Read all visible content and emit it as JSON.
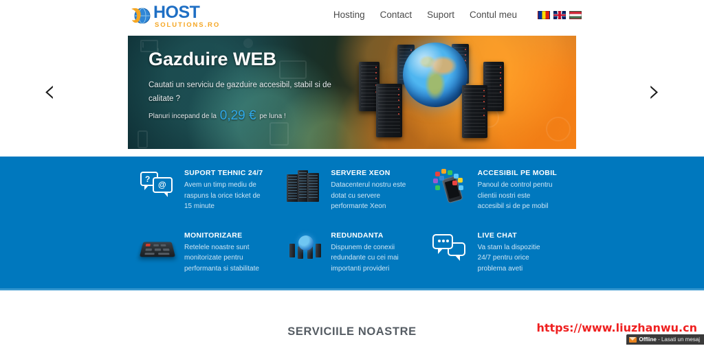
{
  "header": {
    "logo": {
      "name": "HOST",
      "sub": "SOLUTIONS.RO",
      "icon": "globe-swoosh-icon"
    },
    "nav": [
      {
        "label": "Hosting",
        "name": "nav-hosting"
      },
      {
        "label": "Contact",
        "name": "nav-contact"
      },
      {
        "label": "Suport",
        "name": "nav-suport"
      },
      {
        "label": "Contul meu",
        "name": "nav-contul-meu"
      }
    ],
    "flags": [
      {
        "name": "flag-romania",
        "title": "Romana"
      },
      {
        "name": "flag-united-kingdom",
        "title": "English"
      },
      {
        "name": "flag-hungary",
        "title": "Magyar"
      }
    ]
  },
  "slider": {
    "title": "Gazduire WEB",
    "subtitle": "Cautati un serviciu de gazduire accesibil, stabil si de calitate ?",
    "price_prefix": "Planuri incepand de la",
    "price_value": "0,29 €",
    "price_suffix": "pe luna !",
    "price_color": "#2fa8e8",
    "prev_arrow": "‹",
    "next_arrow": "›"
  },
  "features": {
    "background_color": "#0078be",
    "items": [
      {
        "icon": "chat-bubbles-icon",
        "title": "SUPORT TEHNIC 24/7",
        "desc": "Avem un timp mediu de raspuns la orice ticket de 15 minute"
      },
      {
        "icon": "server-rack-icon",
        "title": "SERVERE XEON",
        "desc": "Datacenterul nostru este dotat cu servere performante Xeon"
      },
      {
        "icon": "mobile-phone-apps-icon",
        "title": "ACCESIBIL PE MOBIL",
        "desc": "Panoul de control pentru clientii nostri este accesibil si de pe mobil"
      },
      {
        "icon": "control-panel-icon",
        "title": "MONITORIZARE",
        "desc": "Retelele noastre sunt monitorizate pentru performanta si stabilitate"
      },
      {
        "icon": "network-globe-icon",
        "title": "REDUNDANTA",
        "desc": "Dispunem de conexii redundante cu cei mai importanti provideri"
      },
      {
        "icon": "live-chat-icon",
        "title": "LIVE CHAT",
        "desc": "Va stam la dispozitie 24/7 pentru orice problema aveti"
      }
    ]
  },
  "services": {
    "title": "SERVICIILE NOASTRE"
  },
  "watermark": {
    "url": "https://www.liuzhanwu.cn",
    "color": "#ef2020"
  },
  "chat_widget": {
    "status": "Offline",
    "separator": " - ",
    "message": "Lasati un mesaj",
    "icon": "envelope-icon"
  }
}
